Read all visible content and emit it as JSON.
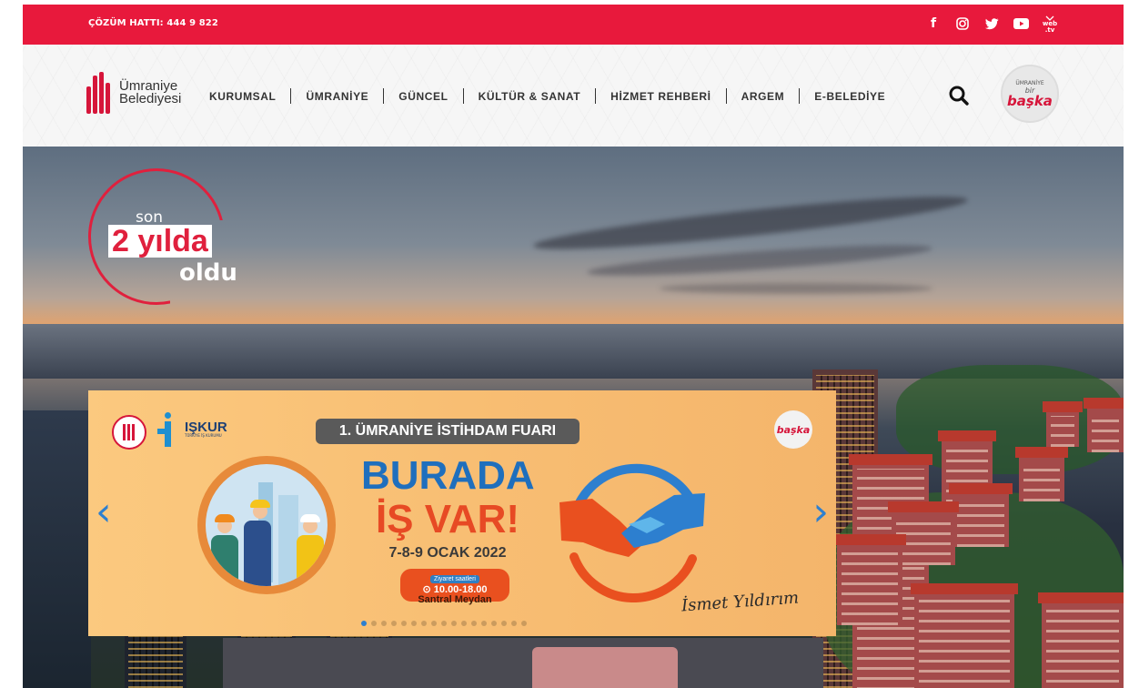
{
  "topbar": {
    "hotline": "ÇÖZÜM HATTI: 444 9 822",
    "social": [
      {
        "icon": "facebook-icon",
        "glyph": "f"
      },
      {
        "icon": "instagram-icon",
        "glyph": "◎"
      },
      {
        "icon": "twitter-icon",
        "glyph": "🐦"
      },
      {
        "icon": "youtube-icon",
        "glyph": "▶"
      },
      {
        "icon": "webtv-icon",
        "glyph": "web tv"
      }
    ],
    "color": "#e8193c"
  },
  "header": {
    "logo_line1": "Ümraniye",
    "logo_line2": "Belediyesi",
    "nav": [
      "KURUMSAL",
      "ÜMRANİYE",
      "GÜNCEL",
      "KÜLTÜR & SANAT",
      "HİZMET REHBERİ",
      "ARGEM",
      "E-BELEDİYE"
    ],
    "badge_top": "ÜMRANİYE",
    "badge_mid": "bir",
    "badge_main": "başka"
  },
  "hero": {
    "stamp_son": "son",
    "stamp_main": "2 yılda",
    "stamp_oldu": "oldu"
  },
  "slide": {
    "iskur_name": "IŞKUR",
    "iskur_sub": "TÜRKİYE İŞ KURUMU",
    "banner": "1. ÜMRANİYE İSTİHDAM FUARI",
    "headline1": "BURADA",
    "headline2": "İŞ VAR!",
    "dates": "7-8-9 OCAK 2022",
    "visit_label": "Ziyaret saatleri",
    "visit_hours": "⊙ 10.00-18.00",
    "visit_place": "Santral Meydan",
    "badge": "başka",
    "signature": "İsmet Yıldırım",
    "dot_count": 17,
    "active_dot": 0,
    "accent": "#2d7fcf"
  }
}
